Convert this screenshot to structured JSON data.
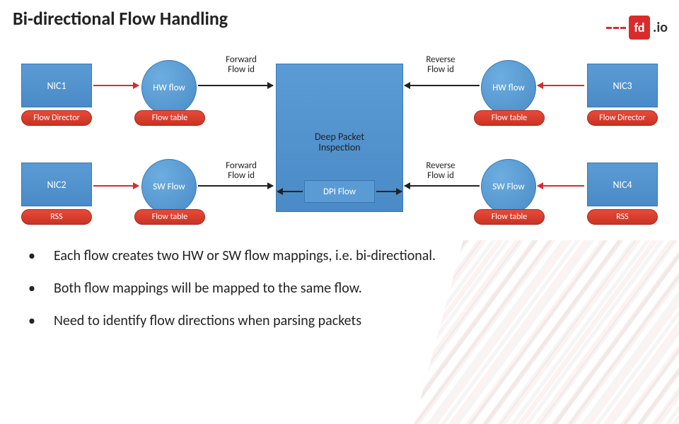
{
  "title": "Bi-directional Flow Handling",
  "logo": {
    "suffix": ".io"
  },
  "diagram": {
    "nic1": "NIC1",
    "nic2": "NIC2",
    "nic3": "NIC3",
    "nic4": "NIC4",
    "flow_director": "Flow Director",
    "rss": "RSS",
    "hw_flow": "HW flow",
    "sw_flow": "SW Flow",
    "flow_table": "Flow table",
    "forward_flow_id": "Forward\nFlow id",
    "reverse_flow_id": "Reverse\nFlow id",
    "dpi": "Deep Packet\nInspection",
    "dpi_inner": "DPI Flow"
  },
  "bullets": [
    "Each flow creates two HW or SW flow mappings, i.e. bi-directional.",
    "Both flow mappings will be mapped to the same flow.",
    "Need to identify flow directions when parsing packets"
  ]
}
